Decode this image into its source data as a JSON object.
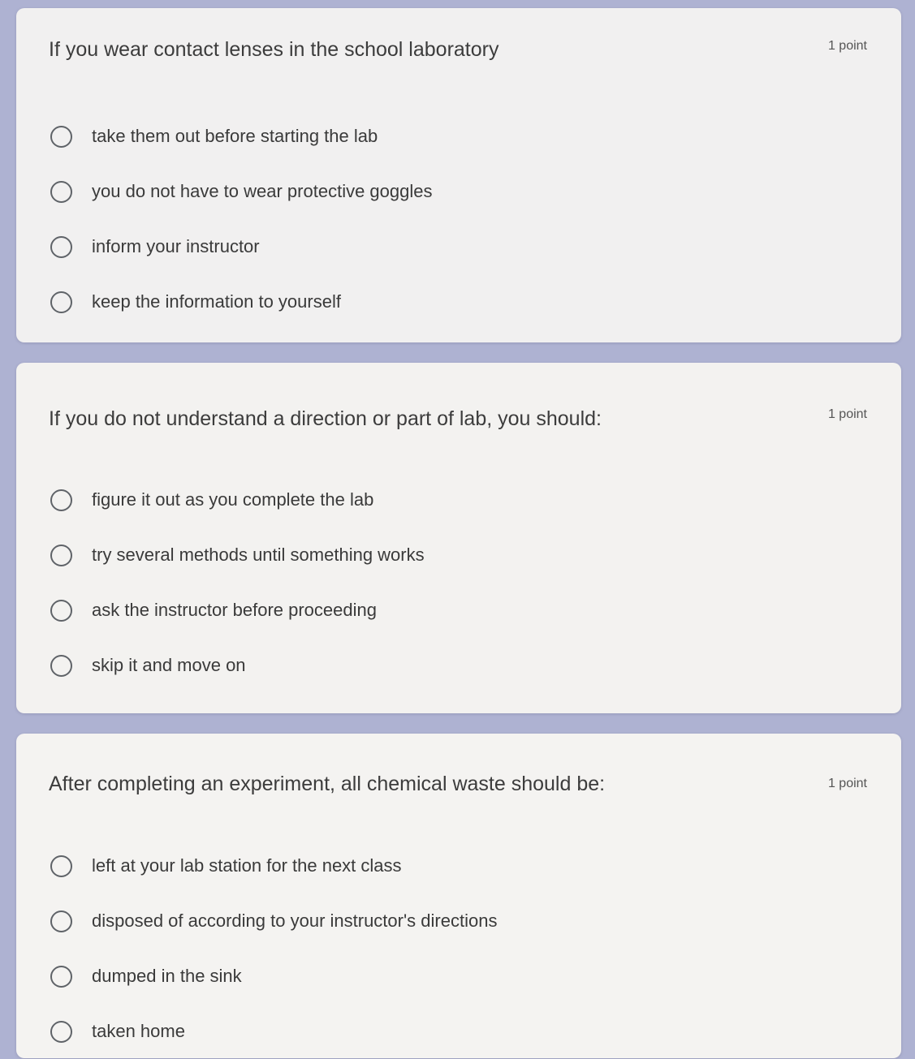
{
  "questions": [
    {
      "title": "If you wear contact lenses in the school laboratory",
      "points": "1 point",
      "options": [
        "take them out before starting the lab",
        "you do not have to wear protective goggles",
        "inform your instructor",
        "keep the information to yourself"
      ]
    },
    {
      "title": "If you do not understand a direction or part of lab, you should:",
      "points": "1 point",
      "options": [
        "figure it out as you complete the lab",
        "try several methods until something works",
        "ask the instructor before proceeding",
        "skip it and move on"
      ]
    },
    {
      "title": "After completing an experiment, all chemical waste should be:",
      "points": "1 point",
      "options": [
        "left at your lab station for the next class",
        "disposed of according to your instructor's directions",
        "dumped in the sink",
        "taken home"
      ]
    }
  ]
}
